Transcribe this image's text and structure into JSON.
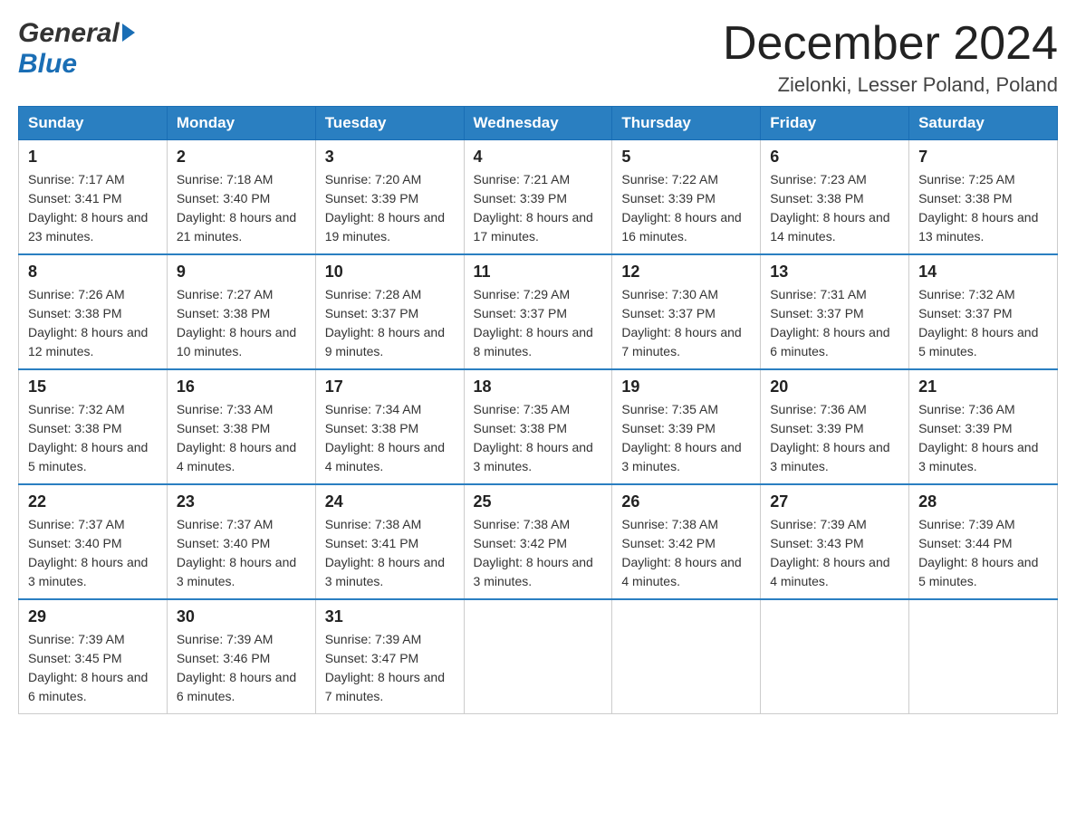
{
  "header": {
    "logo_general": "General",
    "logo_blue": "Blue",
    "month_title": "December 2024",
    "location": "Zielonki, Lesser Poland, Poland"
  },
  "weekdays": [
    "Sunday",
    "Monday",
    "Tuesday",
    "Wednesday",
    "Thursday",
    "Friday",
    "Saturday"
  ],
  "weeks": [
    [
      {
        "day": "1",
        "sunrise": "7:17 AM",
        "sunset": "3:41 PM",
        "daylight": "8 hours and 23 minutes."
      },
      {
        "day": "2",
        "sunrise": "7:18 AM",
        "sunset": "3:40 PM",
        "daylight": "8 hours and 21 minutes."
      },
      {
        "day": "3",
        "sunrise": "7:20 AM",
        "sunset": "3:39 PM",
        "daylight": "8 hours and 19 minutes."
      },
      {
        "day": "4",
        "sunrise": "7:21 AM",
        "sunset": "3:39 PM",
        "daylight": "8 hours and 17 minutes."
      },
      {
        "day": "5",
        "sunrise": "7:22 AM",
        "sunset": "3:39 PM",
        "daylight": "8 hours and 16 minutes."
      },
      {
        "day": "6",
        "sunrise": "7:23 AM",
        "sunset": "3:38 PM",
        "daylight": "8 hours and 14 minutes."
      },
      {
        "day": "7",
        "sunrise": "7:25 AM",
        "sunset": "3:38 PM",
        "daylight": "8 hours and 13 minutes."
      }
    ],
    [
      {
        "day": "8",
        "sunrise": "7:26 AM",
        "sunset": "3:38 PM",
        "daylight": "8 hours and 12 minutes."
      },
      {
        "day": "9",
        "sunrise": "7:27 AM",
        "sunset": "3:38 PM",
        "daylight": "8 hours and 10 minutes."
      },
      {
        "day": "10",
        "sunrise": "7:28 AM",
        "sunset": "3:37 PM",
        "daylight": "8 hours and 9 minutes."
      },
      {
        "day": "11",
        "sunrise": "7:29 AM",
        "sunset": "3:37 PM",
        "daylight": "8 hours and 8 minutes."
      },
      {
        "day": "12",
        "sunrise": "7:30 AM",
        "sunset": "3:37 PM",
        "daylight": "8 hours and 7 minutes."
      },
      {
        "day": "13",
        "sunrise": "7:31 AM",
        "sunset": "3:37 PM",
        "daylight": "8 hours and 6 minutes."
      },
      {
        "day": "14",
        "sunrise": "7:32 AM",
        "sunset": "3:37 PM",
        "daylight": "8 hours and 5 minutes."
      }
    ],
    [
      {
        "day": "15",
        "sunrise": "7:32 AM",
        "sunset": "3:38 PM",
        "daylight": "8 hours and 5 minutes."
      },
      {
        "day": "16",
        "sunrise": "7:33 AM",
        "sunset": "3:38 PM",
        "daylight": "8 hours and 4 minutes."
      },
      {
        "day": "17",
        "sunrise": "7:34 AM",
        "sunset": "3:38 PM",
        "daylight": "8 hours and 4 minutes."
      },
      {
        "day": "18",
        "sunrise": "7:35 AM",
        "sunset": "3:38 PM",
        "daylight": "8 hours and 3 minutes."
      },
      {
        "day": "19",
        "sunrise": "7:35 AM",
        "sunset": "3:39 PM",
        "daylight": "8 hours and 3 minutes."
      },
      {
        "day": "20",
        "sunrise": "7:36 AM",
        "sunset": "3:39 PM",
        "daylight": "8 hours and 3 minutes."
      },
      {
        "day": "21",
        "sunrise": "7:36 AM",
        "sunset": "3:39 PM",
        "daylight": "8 hours and 3 minutes."
      }
    ],
    [
      {
        "day": "22",
        "sunrise": "7:37 AM",
        "sunset": "3:40 PM",
        "daylight": "8 hours and 3 minutes."
      },
      {
        "day": "23",
        "sunrise": "7:37 AM",
        "sunset": "3:40 PM",
        "daylight": "8 hours and 3 minutes."
      },
      {
        "day": "24",
        "sunrise": "7:38 AM",
        "sunset": "3:41 PM",
        "daylight": "8 hours and 3 minutes."
      },
      {
        "day": "25",
        "sunrise": "7:38 AM",
        "sunset": "3:42 PM",
        "daylight": "8 hours and 3 minutes."
      },
      {
        "day": "26",
        "sunrise": "7:38 AM",
        "sunset": "3:42 PM",
        "daylight": "8 hours and 4 minutes."
      },
      {
        "day": "27",
        "sunrise": "7:39 AM",
        "sunset": "3:43 PM",
        "daylight": "8 hours and 4 minutes."
      },
      {
        "day": "28",
        "sunrise": "7:39 AM",
        "sunset": "3:44 PM",
        "daylight": "8 hours and 5 minutes."
      }
    ],
    [
      {
        "day": "29",
        "sunrise": "7:39 AM",
        "sunset": "3:45 PM",
        "daylight": "8 hours and 6 minutes."
      },
      {
        "day": "30",
        "sunrise": "7:39 AM",
        "sunset": "3:46 PM",
        "daylight": "8 hours and 6 minutes."
      },
      {
        "day": "31",
        "sunrise": "7:39 AM",
        "sunset": "3:47 PM",
        "daylight": "8 hours and 7 minutes."
      },
      null,
      null,
      null,
      null
    ]
  ]
}
